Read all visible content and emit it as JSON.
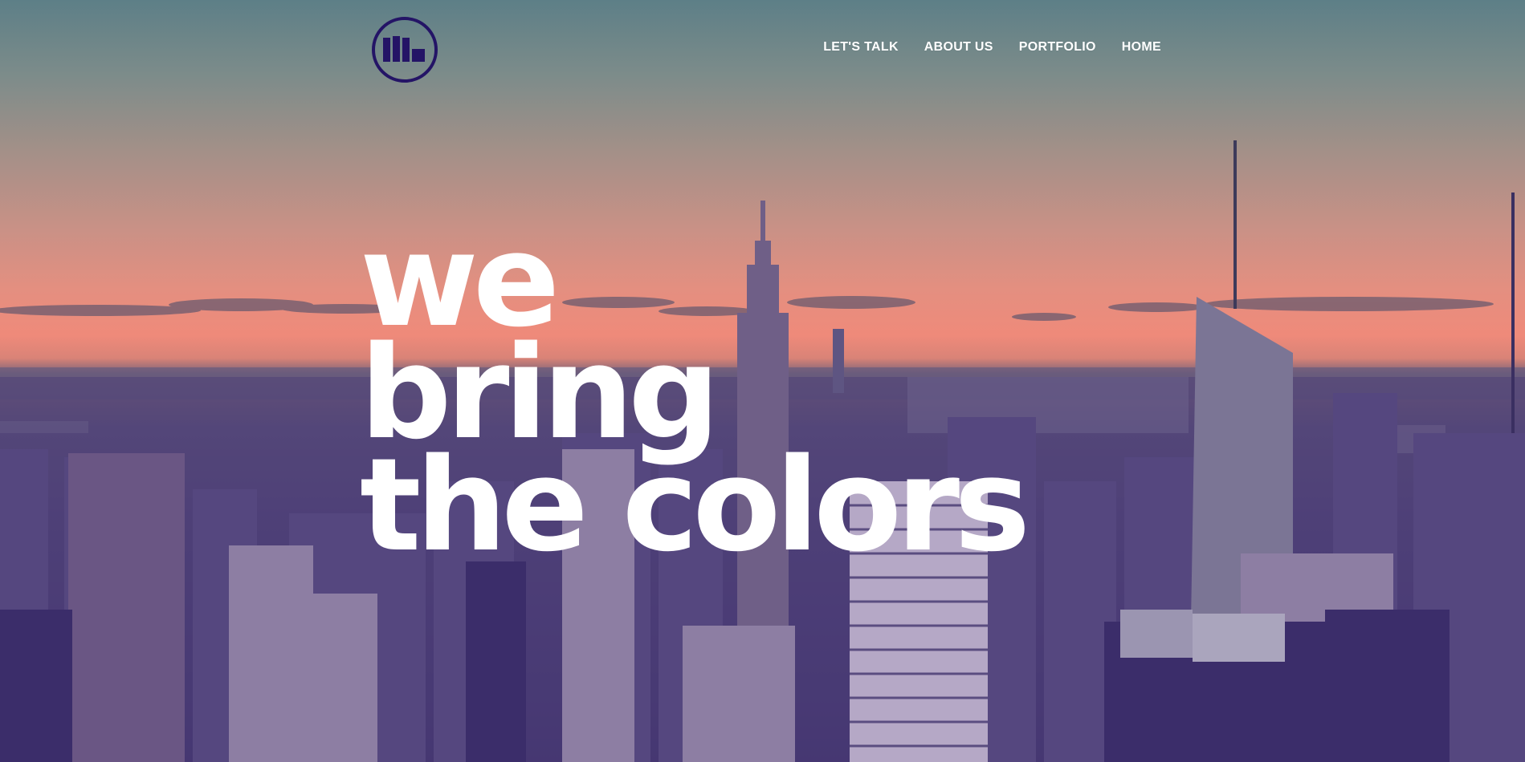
{
  "nav": {
    "items": [
      {
        "label": "LET'S TALK"
      },
      {
        "label": "ABOUT US"
      },
      {
        "label": "PORTFOLIO"
      },
      {
        "label": "HOME"
      }
    ]
  },
  "logo": {
    "icon": "bar-blocks-logo-icon",
    "color": "#241466"
  },
  "hero": {
    "headline_lines": [
      "we",
      "bring",
      "the colors"
    ],
    "background": "city-skyline-at-sunset-purple-duotone"
  },
  "colors": {
    "sky_top": "#5d7f87",
    "sunset": "#ef8a7a",
    "city": "#4d3f79",
    "text": "#ffffff"
  }
}
